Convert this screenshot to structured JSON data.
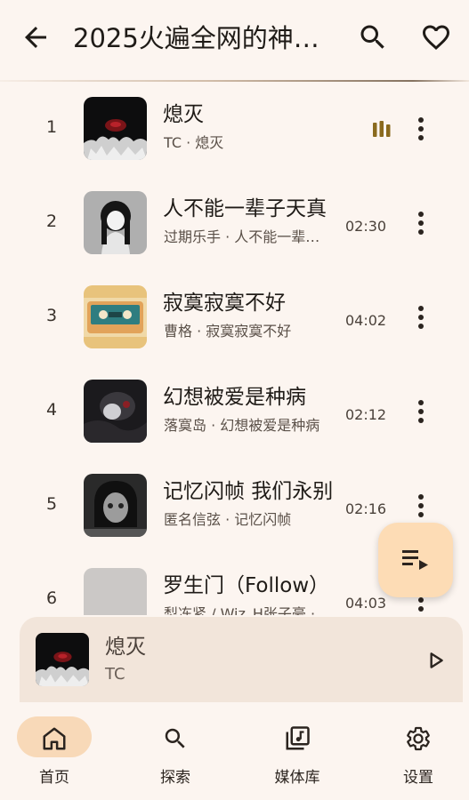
{
  "header": {
    "title": "2025火遍全网的神…",
    "back_icon": "arrow-left-icon",
    "search_icon": "search-icon",
    "favorite_icon": "heart-outline-icon"
  },
  "songs": [
    {
      "index": "1",
      "name": "熄灭",
      "sub": "TC · 熄灭",
      "duration": "",
      "playing": true
    },
    {
      "index": "2",
      "name": "人不能一辈子天真",
      "sub": "过期乐手 · 人不能一辈…",
      "duration": "02:30",
      "playing": false
    },
    {
      "index": "3",
      "name": "寂寞寂寞不好",
      "sub": "曹格 · 寂寞寂寞不好",
      "duration": "04:02",
      "playing": false
    },
    {
      "index": "4",
      "name": "幻想被爱是种病",
      "sub": "落寞岛 · 幻想被爱是种病",
      "duration": "02:12",
      "playing": false
    },
    {
      "index": "5",
      "name": "记忆闪帧 我们永别",
      "sub": "匿名信弦 · 记忆闪帧",
      "duration": "02:16",
      "playing": false
    },
    {
      "index": "6",
      "name": "罗生门（Follow）",
      "sub": "梨冻紧 / Wiz_H张子豪 · …",
      "duration": "04:03",
      "playing": false
    }
  ],
  "player": {
    "title": "熄灭",
    "artist": "TC"
  },
  "nav": {
    "items": [
      {
        "label": "首页",
        "icon": "home-icon",
        "active": true
      },
      {
        "label": "探索",
        "icon": "search-icon",
        "active": false
      },
      {
        "label": "媒体库",
        "icon": "library-music-icon",
        "active": false
      },
      {
        "label": "设置",
        "icon": "settings-gear-icon",
        "active": false
      }
    ]
  },
  "colors": {
    "background": "#fcf5f0",
    "accent": "#fddcb5",
    "nav_active_pill": "#f8d9b8",
    "equalizer": "#8a6a1e"
  }
}
